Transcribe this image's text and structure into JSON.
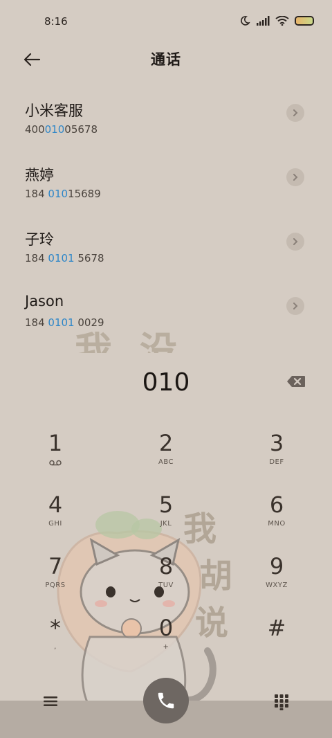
{
  "status": {
    "time": "8:16"
  },
  "header": {
    "title": "通话"
  },
  "contacts": [
    {
      "name": "小米客服",
      "number_pre": "400",
      "number_hl": "010",
      "number_post": "05678"
    },
    {
      "name": "燕婷",
      "number_pre": "184 ",
      "number_hl": "010",
      "number_post": "15689"
    },
    {
      "name": "子玲",
      "number_pre": "184 ",
      "number_hl": "0101",
      "number_post": " 5678"
    },
    {
      "name": "Jason",
      "number_pre": "184 ",
      "number_hl": "0101",
      "number_post": " 0029"
    }
  ],
  "dial": {
    "number": "010"
  },
  "keypad": [
    {
      "digit": "1",
      "letters": ""
    },
    {
      "digit": "2",
      "letters": "ABC"
    },
    {
      "digit": "3",
      "letters": "DEF"
    },
    {
      "digit": "4",
      "letters": "GHI"
    },
    {
      "digit": "5",
      "letters": "JKL"
    },
    {
      "digit": "6",
      "letters": "MNO"
    },
    {
      "digit": "7",
      "letters": "PQRS"
    },
    {
      "digit": "8",
      "letters": "TUV"
    },
    {
      "digit": "9",
      "letters": "WXYZ"
    },
    {
      "digit": "*",
      "letters": ","
    },
    {
      "digit": "0",
      "letters": "+"
    },
    {
      "digit": "#",
      "letters": ""
    }
  ],
  "wallpaper": {
    "watermark_top": "我没样",
    "watermark_side": [
      "我",
      "胡",
      "说"
    ]
  },
  "colors": {
    "background": "#d5ccc3",
    "highlight": "#2e86c8",
    "call_button": "#6e6762",
    "bottom_bar": "#b5aca3"
  },
  "icons": {
    "back": "arrow-left-icon",
    "arrow": "chevron-right-icon",
    "backspace": "backspace-icon",
    "menu": "menu-icon",
    "call": "phone-icon",
    "dialpad": "dialpad-icon"
  }
}
